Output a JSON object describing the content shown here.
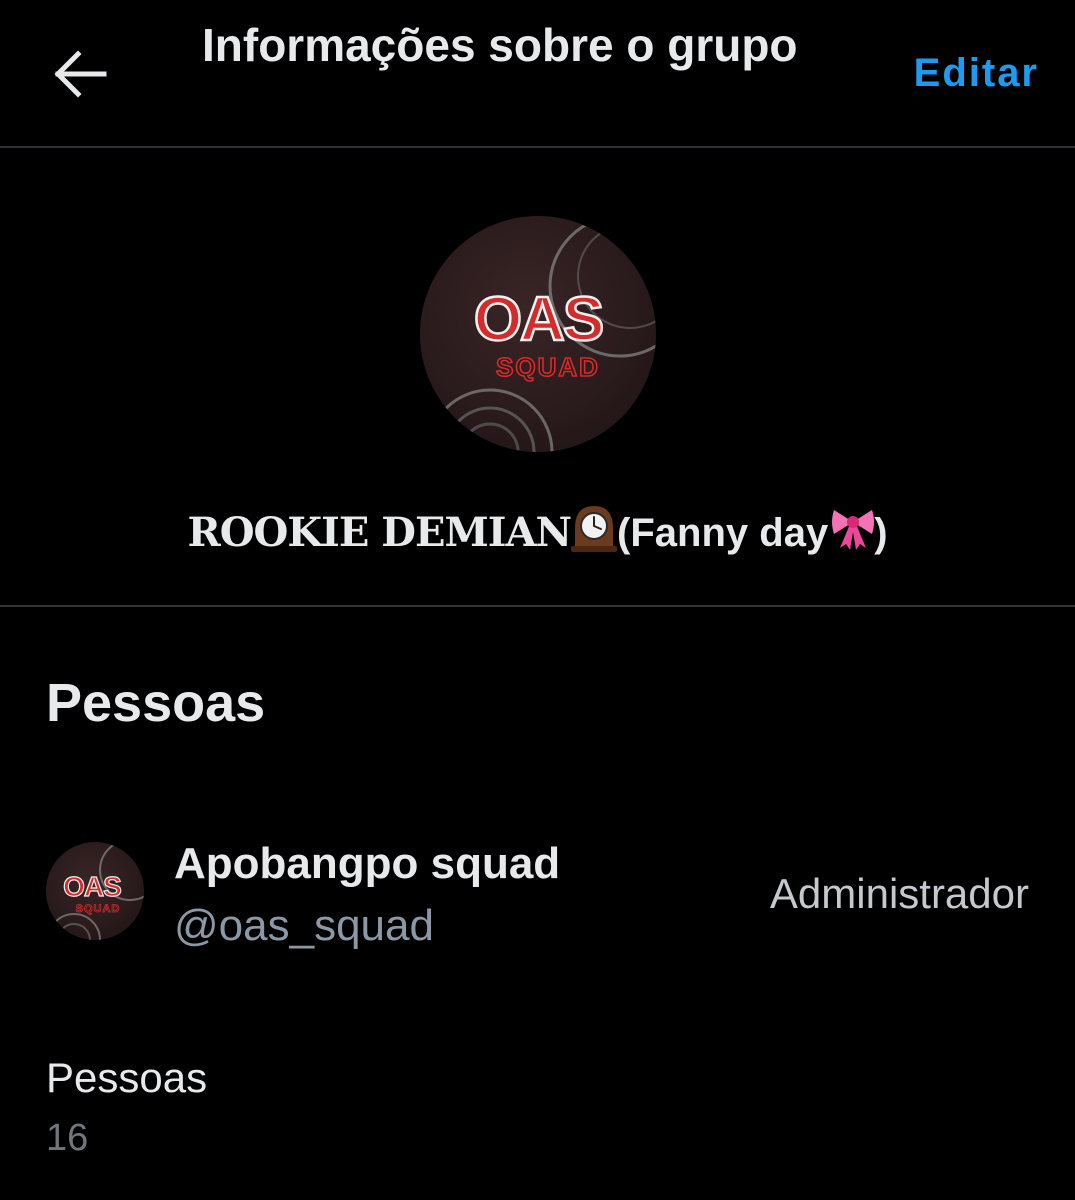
{
  "header": {
    "title": "Informações sobre o grupo",
    "edit_label": "Editar",
    "back_icon": "arrow-left-icon"
  },
  "group": {
    "avatar_text_top": "OAS",
    "avatar_text_bottom": "SQUAD",
    "name_part1": "ROOKIE DEMIAN",
    "name_emoji1": "mantelpiece-clock-icon",
    "name_part2": "(Fanny day",
    "name_emoji2": "ribbon-icon",
    "name_part3": ")"
  },
  "people_section": {
    "title": "Pessoas",
    "members": [
      {
        "name": "Apobangpo squad",
        "handle": "@oas_squad",
        "role": "Administrador",
        "avatar_text_top": "OAS",
        "avatar_text_bottom": "SQUAD"
      }
    ],
    "count_label": "Pessoas",
    "count_value": "16"
  },
  "colors": {
    "background": "#000000",
    "accent": "#1d9bf0",
    "primary_text": "#e7e9ea",
    "secondary_text": "#71767b",
    "divider": "#2f3336",
    "logo_red": "#d42b2b"
  }
}
